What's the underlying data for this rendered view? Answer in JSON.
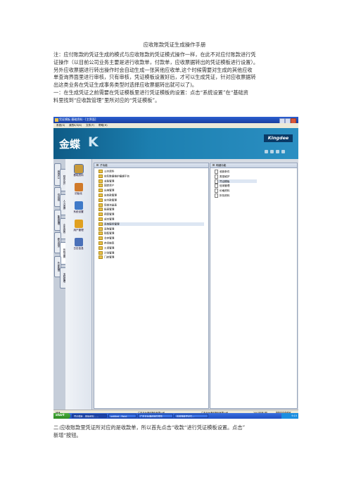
{
  "document": {
    "title": "应收账款凭证生成操作手册",
    "note_lines": [
      "注：应付账款的凭证生成的模式与应收账款的凭证模式操作一样，在此不对应付账款进行凭",
      "证操作（以目前公司业务主要是进行收款单，付款单，应收票据转出的凭证模板进行设置）。",
      "另外应收票据进行转出操作时会自动生成一张其他应收单,这个时候需要对生成的其他应收",
      "单查询界面里进行审核，只有审核，凭证模板设置好后，才可以生成凭证，针对应收票据转",
      "出这类业务在凭证生成事务类型时选择应收票据转出就可以了)。"
    ],
    "step1_lines": [
      "一：在生成凭证之前需要在凭证模板里进行凭证模板的设置：点击“系统设置”在“基础资",
      "料里找到“应收款管理”里所对应的“凭证模板”。"
    ],
    "step2_lines": [
      "二:应收账款里凭证所对应的是收款单，所以首先点击“收款“进行凭证模板设置。点击”",
      "新增“按钮。"
    ]
  },
  "screenshot": {
    "window_title": "凭证模板 基础资料 - [主界面]",
    "menu": [
      "系统(S)",
      "我的K/3(K)",
      "文件(F)",
      "帮助(H)"
    ],
    "brand": "金蝶",
    "brand_k": "K",
    "logo": "Kingdee",
    "vertical_tabs": [
      "我的K/3",
      "财务会计",
      "供应链",
      "人力资源",
      "集团管理",
      "企业绩效",
      "移动商务",
      "系统设置",
      "外部数据",
      "流程管理"
    ],
    "modules": [
      {
        "label": "基础资料",
        "icon": "base-data-icon",
        "color": "#c89a3a"
      },
      {
        "label": "初始化",
        "icon": "init-icon",
        "color": "#d07a2a"
      },
      {
        "label": "系统设置",
        "icon": "system-settings-icon",
        "color": "#3f7ac8"
      },
      {
        "label": "用户管理",
        "icon": "user-management-icon",
        "color": "#e0a020"
      },
      {
        "label": "日志信息",
        "icon": "log-icon",
        "color": "#4a70b8"
      }
    ],
    "left_pane_title": "子功能",
    "left_items": [
      "公共资料",
      "实际数据维护编辑平台",
      "总账管理",
      "固定资产",
      "出纳管理",
      "应收款管理",
      "应付款管理",
      "现金流量表",
      "报表管理",
      "预算管理",
      "成本管理",
      "系统服务管理",
      "采购管理",
      "销售管理",
      "仓存管理",
      "存货核算",
      "工资管理",
      "计划管理",
      "门店管理"
    ],
    "left_selected_index": 11,
    "right_pane_title": "明细功能",
    "right_items": [
      "收款条件",
      "类型维护",
      "凭证模板",
      "信用管理",
      "价格资料",
      "折扣资料"
    ],
    "right_selected_index": 2,
    "status": {
      "left": "就绪",
      "company": "广东天龙通讯股份有限公司",
      "company2": "广东天龙通讯股份有限公司",
      "period": "2007年度1期",
      "user": "Administrator"
    },
    "taskbar": {
      "start": "start",
      "tasks": [
        "凭证模板 - 基础资料 - ...",
        "untitled - Paint",
        "广东天龙通讯软件预览",
        "应收账款凭证生..."
      ],
      "clock": "9:15"
    }
  }
}
